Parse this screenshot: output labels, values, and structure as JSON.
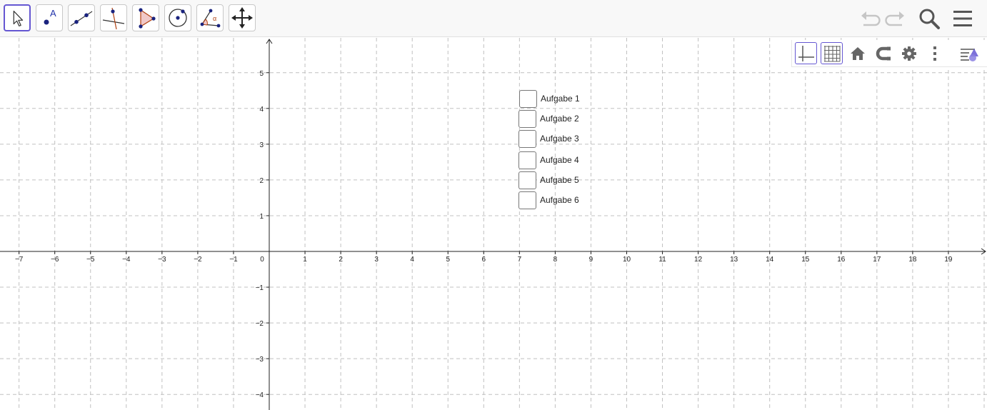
{
  "toolbar": {
    "tools": [
      {
        "name": "move-tool",
        "icon": "arrow-cursor-icon",
        "active": true
      },
      {
        "name": "point-tool",
        "icon": "point-icon",
        "label": "A"
      },
      {
        "name": "line-tool",
        "icon": "line-icon"
      },
      {
        "name": "perpendicular-line-tool",
        "icon": "perpendicular-line-icon"
      },
      {
        "name": "polygon-tool",
        "icon": "polygon-icon"
      },
      {
        "name": "circle-tool",
        "icon": "circle-icon"
      },
      {
        "name": "angle-tool",
        "icon": "angle-icon",
        "label": "α"
      },
      {
        "name": "move-graphics-view-tool",
        "icon": "move-arrows-icon"
      }
    ],
    "right": [
      "undo-icon",
      "redo-icon",
      "search-icon",
      "menu-icon"
    ]
  },
  "style_bar": {
    "buttons": [
      "axes-icon",
      "grid-icon",
      "home-icon",
      "magnet-icon",
      "gear-icon",
      "more-vert-icon",
      "style-bar-toggle-icon"
    ]
  },
  "graph": {
    "x_ticks": [
      "−7",
      "−6",
      "−5",
      "−4",
      "−3",
      "−2",
      "−1",
      "0",
      "1",
      "2",
      "3",
      "4",
      "5",
      "6",
      "7",
      "8",
      "9",
      "10",
      "11",
      "12",
      "13",
      "14",
      "15",
      "16",
      "17",
      "18",
      "19"
    ],
    "y_ticks_pos": [
      "1",
      "2",
      "3",
      "4",
      "5"
    ],
    "y_ticks_neg": [
      "−1",
      "−2",
      "−3",
      "−4"
    ],
    "grid": true,
    "accent": "#6557d2"
  },
  "checkboxes": [
    {
      "label": "Aufgabe 1",
      "checked": false
    },
    {
      "label": "Aufgabe 2",
      "checked": false
    },
    {
      "label": "Aufgabe 3",
      "checked": false
    },
    {
      "label": "Aufgabe 4",
      "checked": false
    },
    {
      "label": "Aufgabe 5",
      "checked": false
    },
    {
      "label": "Aufgabe 6",
      "checked": false
    }
  ]
}
